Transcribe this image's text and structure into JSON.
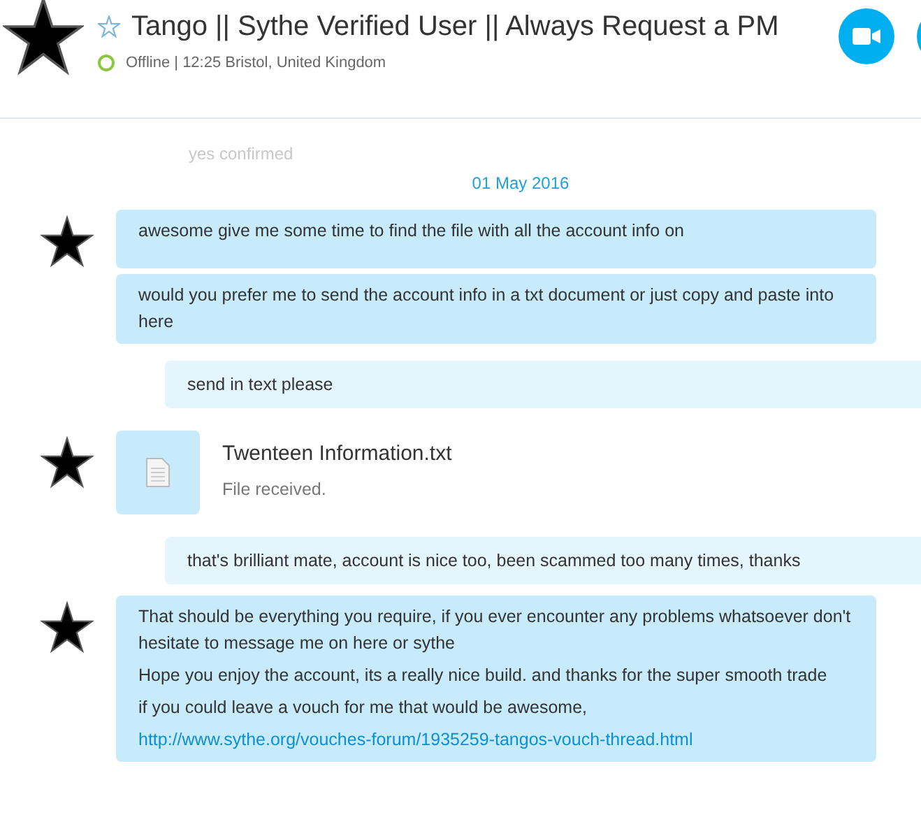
{
  "header": {
    "title": "Tango || Sythe Verified User || Always Request a PM",
    "status_line": "Offline | 12:25 Bristol, United Kingdom"
  },
  "faded_message": "yes confirmed",
  "date": "01 May 2016",
  "messages": [
    {
      "kind": "incoming",
      "avatar": true,
      "paragraphs": [
        {
          "kind": "text",
          "text": "awesome give me some time to find the file with all the account info on"
        }
      ]
    },
    {
      "kind": "incoming",
      "avatar": false,
      "paragraphs": [
        {
          "kind": "text",
          "text": "would you prefer me to send the account info in a txt document or just copy and paste into here"
        }
      ]
    },
    {
      "kind": "outgoing",
      "text": "send in text please"
    },
    {
      "kind": "file",
      "avatar": true,
      "file_name": "Twenteen Information.txt",
      "file_status": "File received."
    },
    {
      "kind": "outgoing",
      "text": "that's brilliant mate, account is nice too, been scammed too many times, thanks"
    },
    {
      "kind": "incoming",
      "avatar": true,
      "paragraphs": [
        {
          "kind": "text",
          "text": "That should be everything you require, if you ever encounter any problems whatsoever don't hesitate to message me on here or sythe"
        },
        {
          "kind": "text",
          "text": "Hope you enjoy the account, its a really nice build. and thanks for the super smooth trade"
        },
        {
          "kind": "text",
          "text": "if you could leave a vouch for me that would be awesome,"
        },
        {
          "kind": "link",
          "text": "http://www.sythe.org/vouches-forum/1935259-tangos-vouch-thread.html"
        }
      ]
    }
  ]
}
